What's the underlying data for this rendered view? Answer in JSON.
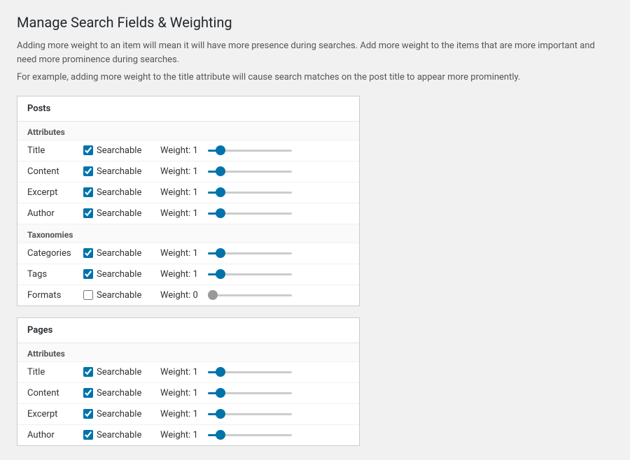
{
  "page": {
    "title": "Manage Search Fields & Weighting",
    "description1": "Adding more weight to an item will mean it will have more presence during searches. Add more weight to the items that are more important and need more prominence during searches.",
    "description2": "For example, adding more weight to the title attribute will cause search matches on the post title to appear more prominently."
  },
  "sections": [
    {
      "id": "posts",
      "title": "Posts",
      "groups": [
        {
          "label": "Attributes",
          "fields": [
            {
              "name": "Title",
              "searchable": true,
              "weight": 1,
              "active": true
            },
            {
              "name": "Content",
              "searchable": true,
              "weight": 1,
              "active": true
            },
            {
              "name": "Excerpt",
              "searchable": true,
              "weight": 1,
              "active": true
            },
            {
              "name": "Author",
              "searchable": true,
              "weight": 1,
              "active": true
            }
          ]
        },
        {
          "label": "Taxonomies",
          "fields": [
            {
              "name": "Categories",
              "searchable": true,
              "weight": 1,
              "active": true
            },
            {
              "name": "Tags",
              "searchable": true,
              "weight": 1,
              "active": true
            },
            {
              "name": "Formats",
              "searchable": false,
              "weight": 0,
              "active": false
            }
          ]
        }
      ]
    },
    {
      "id": "pages",
      "title": "Pages",
      "groups": [
        {
          "label": "Attributes",
          "fields": [
            {
              "name": "Title",
              "searchable": true,
              "weight": 1,
              "active": true
            },
            {
              "name": "Content",
              "searchable": true,
              "weight": 1,
              "active": true
            },
            {
              "name": "Excerpt",
              "searchable": true,
              "weight": 1,
              "active": true
            },
            {
              "name": "Author",
              "searchable": true,
              "weight": 1,
              "active": true
            }
          ]
        }
      ]
    }
  ],
  "labels": {
    "searchable": "Searchable",
    "weight_prefix": "Weight: "
  }
}
